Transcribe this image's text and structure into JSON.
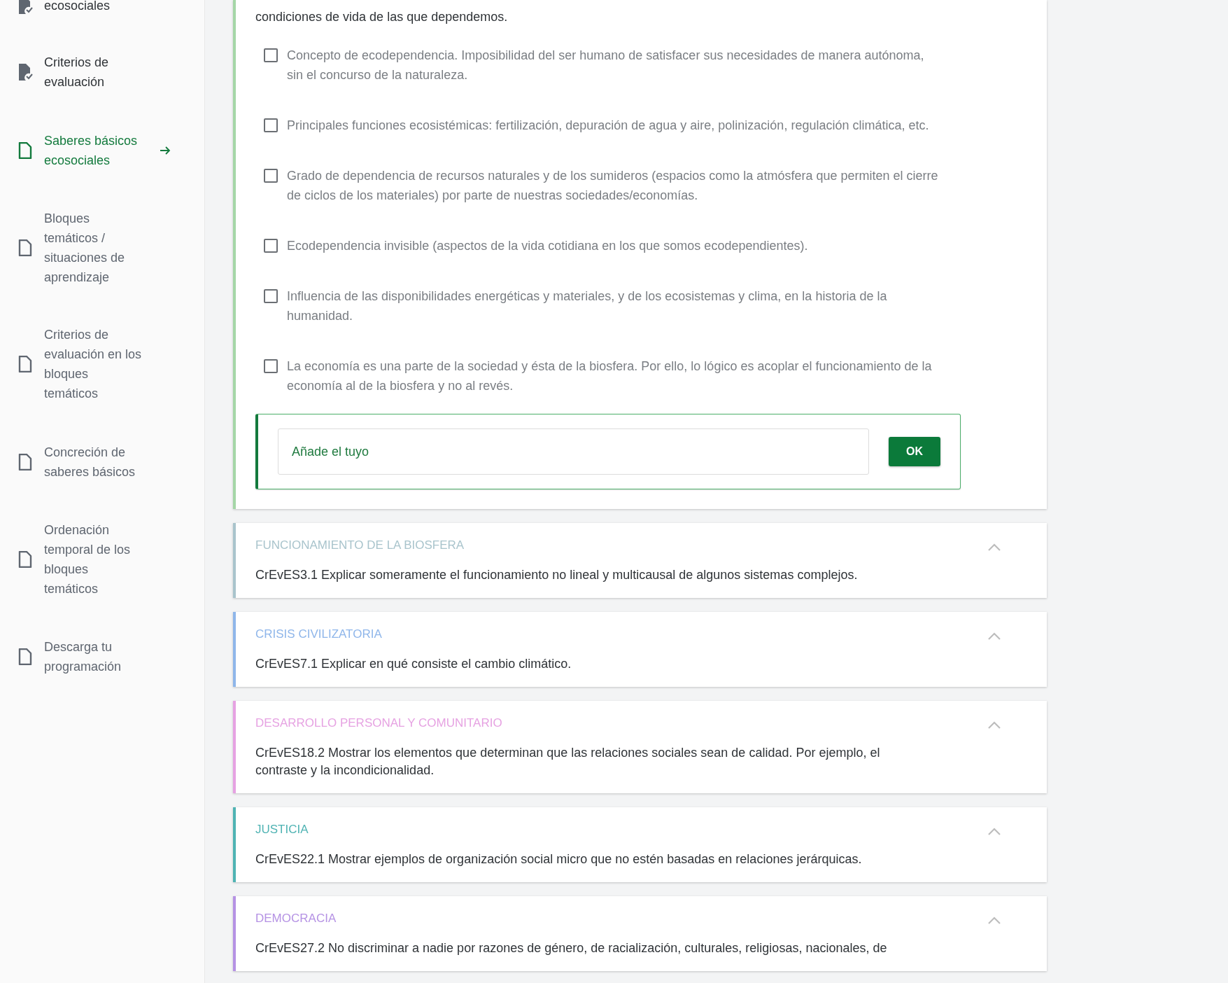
{
  "sidebar": {
    "items": [
      {
        "label": "ecosociales",
        "kind": "doc-check",
        "selected": false
      },
      {
        "label": "Criterios de evaluación",
        "kind": "doc-check",
        "selected": false
      },
      {
        "label": "Saberes básicos ecosociales",
        "kind": "doc",
        "selected": true
      },
      {
        "label": "Bloques temáticos / situaciones de aprendizaje",
        "kind": "doc",
        "selected": false
      },
      {
        "label": "Criterios de evaluación en los bloques temáticos",
        "kind": "doc",
        "selected": false
      },
      {
        "label": "Concreción de saberes básicos",
        "kind": "doc",
        "selected": false
      },
      {
        "label": "Ordenación temporal de los bloques temáticos",
        "kind": "doc",
        "selected": false
      },
      {
        "label": "Descarga tu programación",
        "kind": "doc",
        "selected": false
      }
    ]
  },
  "active_card": {
    "criterion": "condiciones de vida de las que dependemos.",
    "items": [
      {
        "label": "Concepto de ecodependencia. Imposibilidad del ser humano de satisfacer sus necesidades de manera autónoma, sin el concurso de la naturaleza.",
        "checked": false
      },
      {
        "label": "Principales funciones ecosistémicas: fertilización, depuración de agua y aire, polinización, regulación climática, etc.",
        "checked": false
      },
      {
        "label": "Grado de dependencia de recursos naturales y de los sumideros (espacios como la atmósfera que permiten el cierre de ciclos de los materiales) por parte de nuestras sociedades/economías.",
        "checked": false
      },
      {
        "label": "Ecodependencia invisible (aspectos de la vida cotidiana en los que somos ecodependientes).",
        "checked": false
      },
      {
        "label": "Influencia de las disponibilidades energéticas y materiales, y de los ecosistemas y clima, en la historia de la humanidad.",
        "checked": false
      },
      {
        "label": "La economía es una parte de la sociedad y ésta de la biosfera. Por ello, lo lógico es acoplar el funcionamiento de la economía al de la biosfera y no al revés.",
        "checked": false
      }
    ],
    "add_field": {
      "placeholder": "Añade el tuyo"
    },
    "button": "OK"
  },
  "sections": [
    {
      "title": "FUNCIONAMIENTO DE LA BIOSFERA",
      "color": "#a9c4cc",
      "expanded": true,
      "criterion": "CrEvES3.1 Explicar someramente el funcionamiento no lineal y multicausal de algunos sistemas complejos."
    },
    {
      "title": "CRISIS CIVILIZATORIA",
      "color": "#8fb6ea",
      "expanded": true,
      "criterion": "CrEvES7.1 Explicar en qué consiste el cambio climático."
    },
    {
      "title": "DESARROLLO PERSONAL Y COMUNITARIO",
      "color": "#e6a2e2",
      "expanded": true,
      "criterion": "CrEvES18.2 Mostrar los elementos que determinan que las relaciones sociales sean de calidad. Por ejemplo, el contraste y la incondicionalidad."
    },
    {
      "title": "JUSTICIA",
      "color": "#4fb3b3",
      "expanded": true,
      "criterion": "CrEvES22.1 Mostrar ejemplos de organización social micro que no estén basadas en relaciones jerárquicas."
    },
    {
      "title": "DEMOCRACIA",
      "color": "#b592e4",
      "expanded": true,
      "criterion": "CrEvES27.2 No discriminar a nadie por razones de género, de racialización, culturales, religiosas, nacionales, de"
    }
  ]
}
